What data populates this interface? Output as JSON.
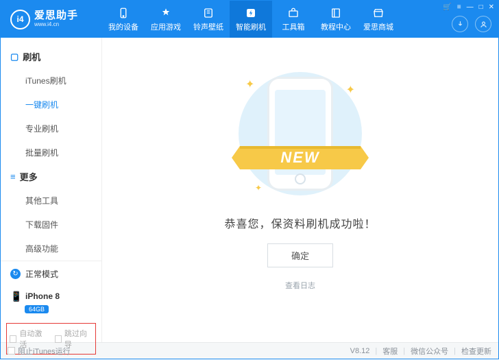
{
  "logo": {
    "glyph": "i4",
    "cn": "爱思助手",
    "en": "www.i4.cn"
  },
  "nav": [
    {
      "label": "我的设备",
      "icon": "phone"
    },
    {
      "label": "应用游戏",
      "icon": "apps"
    },
    {
      "label": "铃声壁纸",
      "icon": "ring"
    },
    {
      "label": "智能刷机",
      "icon": "flash",
      "active": true
    },
    {
      "label": "工具箱",
      "icon": "toolbox"
    },
    {
      "label": "教程中心",
      "icon": "book"
    },
    {
      "label": "爱思商城",
      "icon": "shop"
    }
  ],
  "sidebar": {
    "group1": {
      "title": "刷机",
      "items": [
        "iTunes刷机",
        "一键刷机",
        "专业刷机",
        "批量刷机"
      ],
      "active_index": 1
    },
    "group2": {
      "title": "更多",
      "items": [
        "其他工具",
        "下载固件",
        "高级功能"
      ]
    }
  },
  "mode": {
    "label": "正常模式"
  },
  "device": {
    "name": "iPhone 8",
    "storage": "64GB"
  },
  "options": {
    "auto_activate": "自动激活",
    "skip_guide": "跳过向导"
  },
  "main": {
    "ribbon": "NEW",
    "message": "恭喜您，保资料刷机成功啦！",
    "ok": "确定",
    "log": "查看日志"
  },
  "footer": {
    "block_itunes": "阻止iTunes运行",
    "version": "V8.12",
    "support": "客服",
    "wechat": "微信公众号",
    "update": "检查更新"
  }
}
